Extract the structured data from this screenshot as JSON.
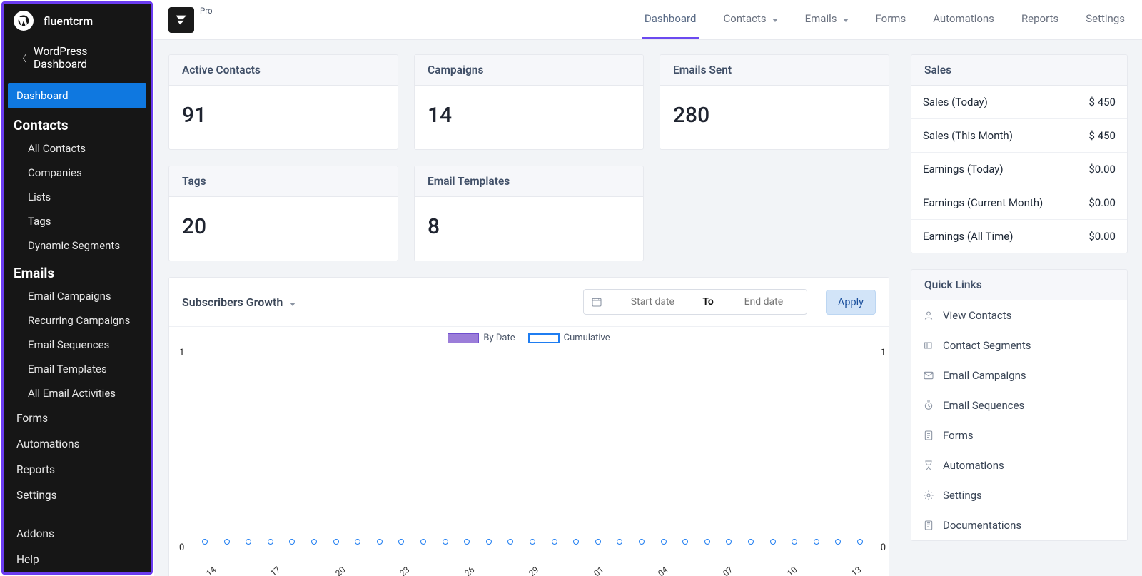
{
  "sidebar": {
    "title": "fluentcrm",
    "back_label": "WordPress Dashboard",
    "items": {
      "dashboard": "Dashboard",
      "contacts_head": "Contacts",
      "all_contacts": "All Contacts",
      "companies": "Companies",
      "lists": "Lists",
      "tags": "Tags",
      "dynamic_segments": "Dynamic Segments",
      "emails_head": "Emails",
      "email_campaigns": "Email Campaigns",
      "recurring_campaigns": "Recurring Campaigns",
      "email_sequences": "Email Sequences",
      "email_templates": "Email Templates",
      "all_email_activities": "All Email Activities",
      "forms": "Forms",
      "automations": "Automations",
      "reports": "Reports",
      "settings": "Settings",
      "addons": "Addons",
      "help": "Help"
    }
  },
  "topbar": {
    "pro": "Pro",
    "tabs": {
      "dashboard": "Dashboard",
      "contacts": "Contacts",
      "emails": "Emails",
      "forms": "Forms",
      "automations": "Automations",
      "reports": "Reports",
      "settings": "Settings"
    }
  },
  "stats": {
    "active_contacts": {
      "label": "Active Contacts",
      "value": "91"
    },
    "campaigns": {
      "label": "Campaigns",
      "value": "14"
    },
    "emails_sent": {
      "label": "Emails Sent",
      "value": "280"
    },
    "tags": {
      "label": "Tags",
      "value": "20"
    },
    "email_templates": {
      "label": "Email Templates",
      "value": "8"
    }
  },
  "sales": {
    "title": "Sales",
    "rows": [
      {
        "label": "Sales (Today)",
        "value": "$ 450"
      },
      {
        "label": "Sales (This Month)",
        "value": "$ 450"
      },
      {
        "label": "Earnings (Today)",
        "value": "$0.00"
      },
      {
        "label": "Earnings (Current Month)",
        "value": "$0.00"
      },
      {
        "label": "Earnings (All Time)",
        "value": "$0.00"
      }
    ]
  },
  "quick_links": {
    "title": "Quick Links",
    "items": [
      "View Contacts",
      "Contact Segments",
      "Email Campaigns",
      "Email Sequences",
      "Forms",
      "Automations",
      "Settings",
      "Documentations"
    ]
  },
  "chart": {
    "title": "Subscribers Growth",
    "start_placeholder": "Start date",
    "to": "To",
    "end_placeholder": "End date",
    "apply": "Apply",
    "legend_by_date": "By Date",
    "legend_cumulative": "Cumulative"
  },
  "chart_data": {
    "type": "line",
    "title": "Subscribers Growth",
    "xlabel": "",
    "ylabel_left": "",
    "ylabel_right": "",
    "ylim_left": [
      0,
      1
    ],
    "ylim_right": [
      0,
      1
    ],
    "x_ticks": [
      "14",
      "17",
      "20",
      "23",
      "26",
      "29",
      "01",
      "04",
      "07",
      "10",
      "13"
    ],
    "series": [
      {
        "name": "By Date",
        "color": "#9b7dd9",
        "values": [
          0,
          0,
          0,
          0,
          0,
          0,
          0,
          0,
          0,
          0,
          0,
          0,
          0,
          0,
          0,
          0,
          0,
          0,
          0,
          0,
          0,
          0,
          0,
          0,
          0,
          0,
          0,
          0,
          0,
          0,
          0
        ]
      },
      {
        "name": "Cumulative",
        "color": "#1f7df1",
        "values": [
          0,
          0,
          0,
          0,
          0,
          0,
          0,
          0,
          0,
          0,
          0,
          0,
          0,
          0,
          0,
          0,
          0,
          0,
          0,
          0,
          0,
          0,
          0,
          0,
          0,
          0,
          0,
          0,
          0,
          0,
          0
        ]
      }
    ]
  }
}
